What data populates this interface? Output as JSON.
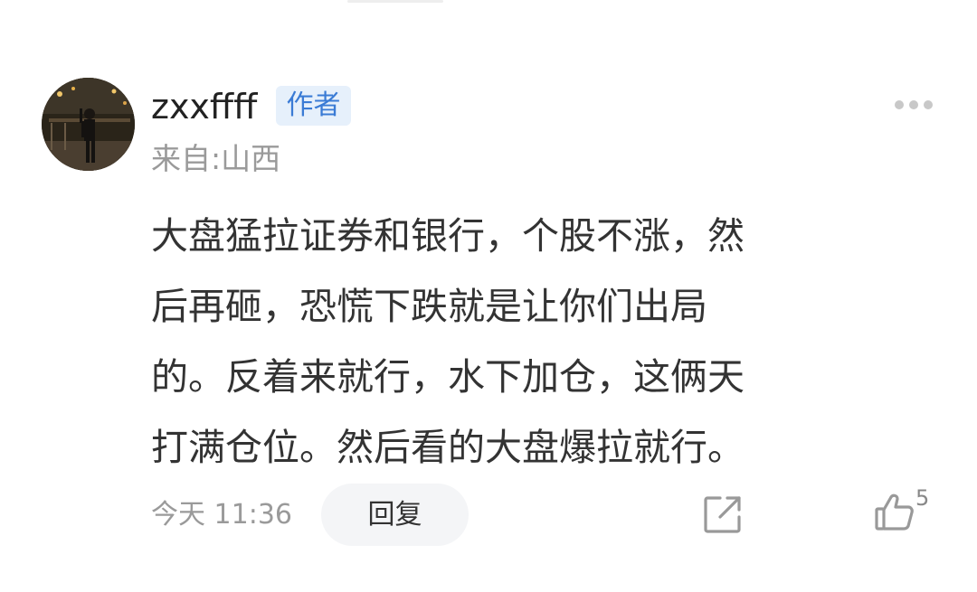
{
  "comment": {
    "username": "zxxffff",
    "author_badge": "作者",
    "location": "来自:山西",
    "text_lines": [
      "大盘猛拉证券和银行，个股不涨，然",
      "后再砸，恐慌下跌就是让你们出局",
      "的。反着来就行，水下加仓，这俩天",
      "打满仓位。然后看的大盘爆拉就行。"
    ],
    "timestamp": "今天 11:36",
    "reply_label": "回复",
    "like_count": "5"
  },
  "icons": {
    "more": "more-dots-icon",
    "share": "share-icon",
    "like": "thumbs-up-icon"
  },
  "colors": {
    "badge_bg": "#e6f0fb",
    "badge_text": "#3a7bd5",
    "secondary_text": "#9a9a9a",
    "body_text": "#333333"
  }
}
